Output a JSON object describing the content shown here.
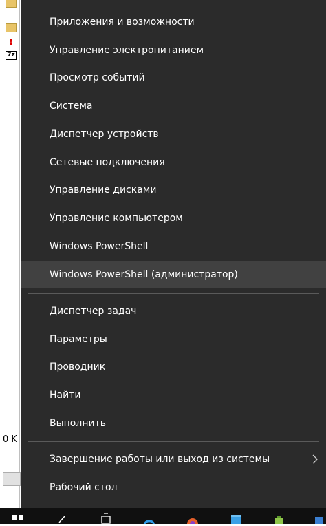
{
  "background": {
    "partial_status_text": "0 K",
    "icons": [
      "folder-icon",
      "folder-icon",
      "warning-icon",
      "7z-archive-icon"
    ],
    "sevenz_label": "7z",
    "warn_glyph": "!"
  },
  "menu": {
    "items": [
      {
        "label": "Приложения и возможности"
      },
      {
        "label": "Управление электропитанием"
      },
      {
        "label": "Просмотр событий"
      },
      {
        "label": "Система"
      },
      {
        "label": "Диспетчер устройств"
      },
      {
        "label": "Сетевые подключения"
      },
      {
        "label": "Управление дисками"
      },
      {
        "label": "Управление компьютером"
      },
      {
        "label": "Windows PowerShell"
      },
      {
        "label": "Windows PowerShell (администратор)"
      },
      {
        "label": "Диспетчер задач"
      },
      {
        "label": "Параметры"
      },
      {
        "label": "Проводник"
      },
      {
        "label": "Найти"
      },
      {
        "label": "Выполнить"
      },
      {
        "label": "Завершение работы или выход из системы"
      },
      {
        "label": "Рабочий стол"
      }
    ],
    "hovered_item": "Windows PowerShell (администратор)"
  },
  "taskbar": {
    "icons": [
      "start-icon",
      "search-icon",
      "task-view-icon",
      "browser-icon",
      "firefox-icon",
      "store-icon",
      "app-icon",
      "more-icon"
    ]
  },
  "colors": {
    "menu_bg": "#2b2b2b",
    "menu_hover": "#414141",
    "separator": "#5a5a5a",
    "text": "#ffffff"
  }
}
